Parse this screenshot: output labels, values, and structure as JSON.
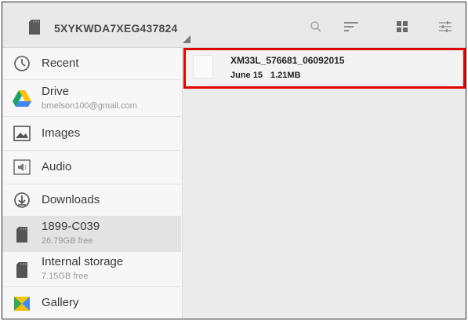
{
  "header": {
    "title": "5XYKWDA7XEG437824",
    "icons": [
      "sd-card-icon",
      "search-icon",
      "sort-icon",
      "grid-view-icon",
      "settings-sliders-icon"
    ]
  },
  "sidebar": {
    "items": [
      {
        "label": "Recent",
        "icon": "clock-icon"
      },
      {
        "label": "Drive",
        "sub": "brnelson100@gmail.com",
        "icon": "drive-icon"
      },
      {
        "label": "Images",
        "icon": "image-icon"
      },
      {
        "label": "Audio",
        "icon": "audio-icon"
      },
      {
        "label": "Downloads",
        "icon": "download-icon"
      },
      {
        "label": "1899-C039",
        "sub": "26.79GB free",
        "icon": "sd-card-icon",
        "selected": true
      },
      {
        "label": "Internal storage",
        "sub": "7.15GB free",
        "icon": "sd-card-icon"
      },
      {
        "label": "Gallery",
        "icon": "gallery-icon"
      }
    ]
  },
  "files": [
    {
      "name": "XM33L_576681_06092015",
      "date": "June 15",
      "size": "1.21MB"
    }
  ],
  "colors": {
    "highlight": "#e10000",
    "drive_green": "#1aa260",
    "drive_yellow": "#ffc107",
    "drive_blue": "#4285f4"
  }
}
